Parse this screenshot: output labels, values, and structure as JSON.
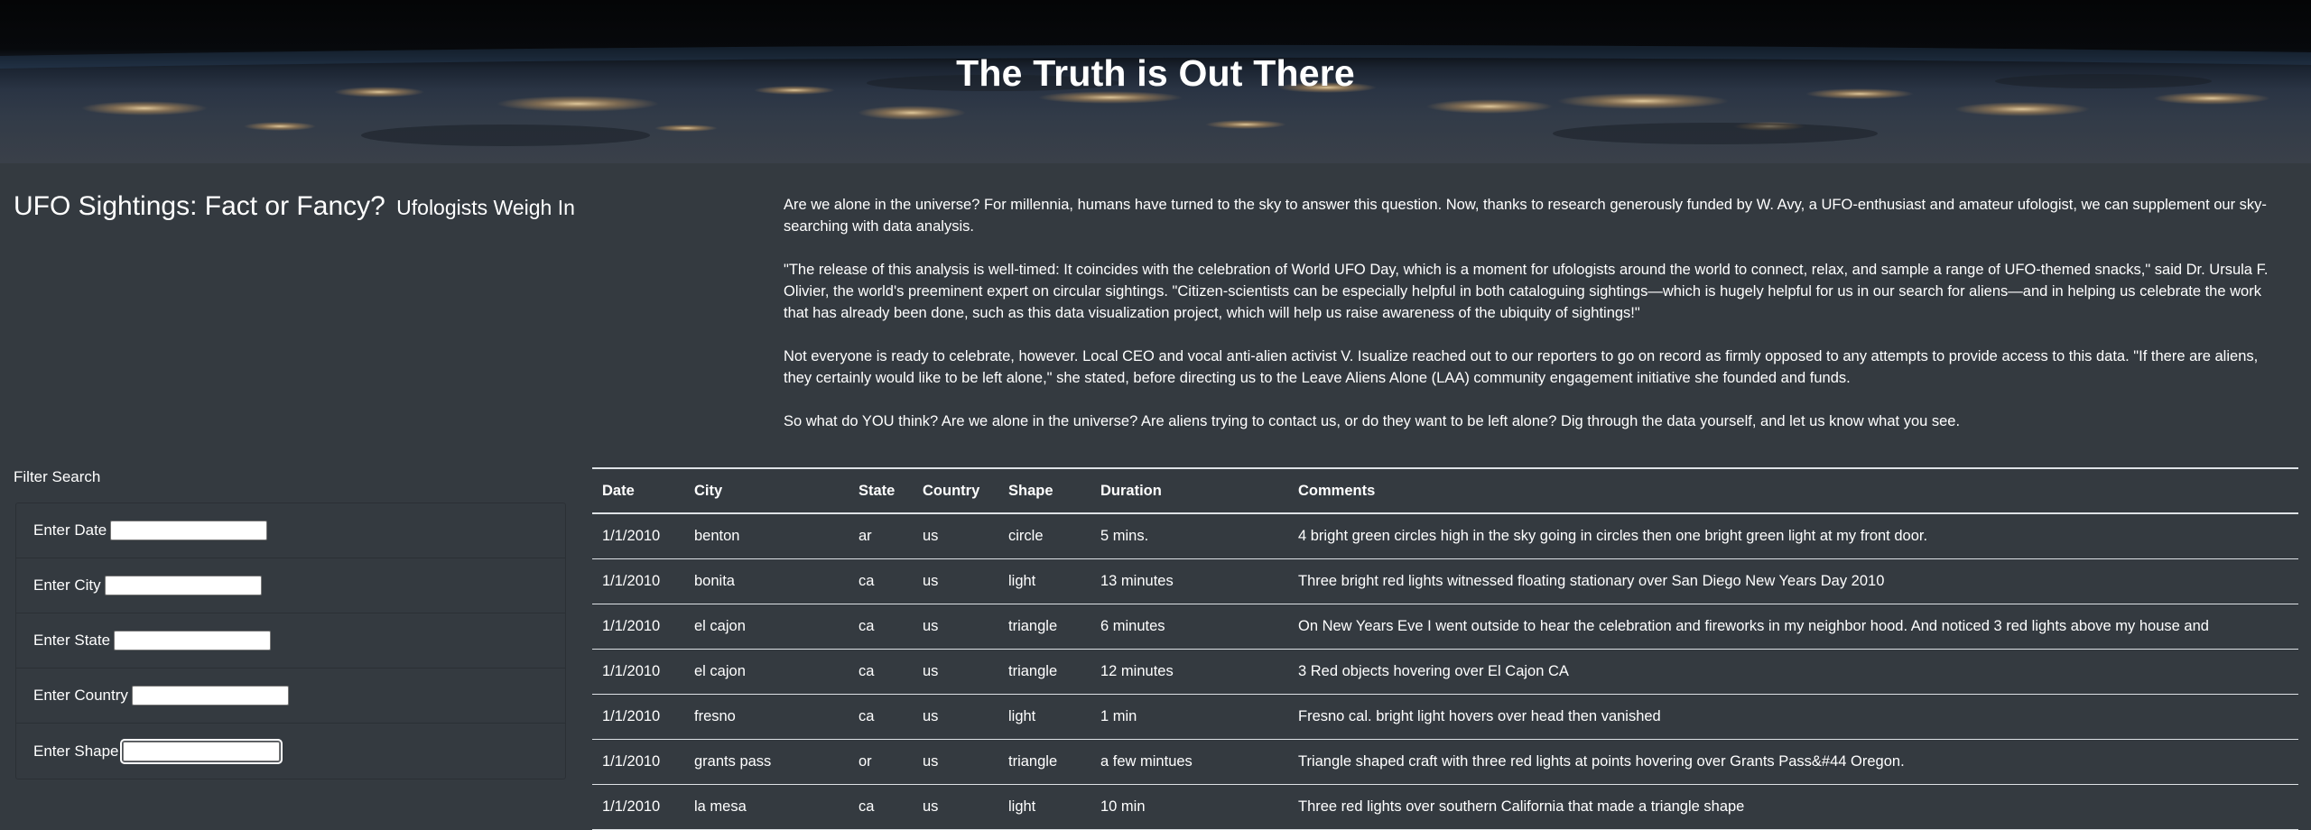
{
  "hero": {
    "title": "The Truth is Out There"
  },
  "intro": {
    "heading": "UFO Sightings: Fact or Fancy?",
    "subheading": "Ufologists Weigh In"
  },
  "article": {
    "paragraphs": [
      "Are we alone in the universe? For millennia, humans have turned to the sky to answer this question. Now, thanks to research generously funded by W. Avy, a UFO-enthusiast and amateur ufologist, we can supplement our sky-searching with data analysis.",
      "\"The release of this analysis is well-timed: It coincides with the celebration of World UFO Day, which is a moment for ufologists around the world to connect, relax, and sample a range of UFO-themed snacks,\" said Dr. Ursula F. Olivier, the world's preeminent expert on circular sightings. \"Citizen-scientists can be especially helpful in both cataloguing sightings—which is hugely helpful for us in our search for aliens—and in helping us celebrate the work that has already been done, such as this data visualization project, which will help us raise awareness of the ubiquity of sightings!\"",
      "Not everyone is ready to celebrate, however. Local CEO and vocal anti-alien activist V. Isualize reached out to our reporters to go on record as firmly opposed to any attempts to provide access to this data. \"If there are aliens, they certainly would like to be left alone,\" she stated, before directing us to the Leave Aliens Alone (LAA) community engagement initiative she founded and funds.",
      "So what do YOU think? Are we alone in the universe? Are aliens trying to contact us, or do they want to be left alone? Dig through the data yourself, and let us know what you see."
    ]
  },
  "filters": {
    "title": "Filter Search",
    "items": [
      {
        "label": "Enter Date",
        "value": ""
      },
      {
        "label": "Enter City",
        "value": ""
      },
      {
        "label": "Enter State",
        "value": ""
      },
      {
        "label": "Enter Country",
        "value": ""
      },
      {
        "label": "Enter Shape",
        "value": ""
      }
    ]
  },
  "table": {
    "columns": [
      "Date",
      "City",
      "State",
      "Country",
      "Shape",
      "Duration",
      "Comments"
    ],
    "rows": [
      [
        "1/1/2010",
        "benton",
        "ar",
        "us",
        "circle",
        "5 mins.",
        "4 bright green circles high in the sky going in circles then one bright green light at my front door."
      ],
      [
        "1/1/2010",
        "bonita",
        "ca",
        "us",
        "light",
        "13 minutes",
        "Three bright red lights witnessed floating stationary over San Diego New Years Day 2010"
      ],
      [
        "1/1/2010",
        "el cajon",
        "ca",
        "us",
        "triangle",
        "6 minutes",
        "On New Years Eve I went outside to hear the celebration and fireworks in my neighbor hood. And noticed 3 red lights above my house and"
      ],
      [
        "1/1/2010",
        "el cajon",
        "ca",
        "us",
        "triangle",
        "12 minutes",
        "3 Red objects hovering over El Cajon CA"
      ],
      [
        "1/1/2010",
        "fresno",
        "ca",
        "us",
        "light",
        "1 min",
        "Fresno cal. bright light hovers over head then vanished"
      ],
      [
        "1/1/2010",
        "grants pass",
        "or",
        "us",
        "triangle",
        "a few mintues",
        "Triangle shaped craft with three red lights at points hovering over Grants Pass&#44 Oregon."
      ],
      [
        "1/1/2010",
        "la mesa",
        "ca",
        "us",
        "light",
        "10 min",
        "Three red lights over southern California that made a triangle shape"
      ]
    ]
  }
}
